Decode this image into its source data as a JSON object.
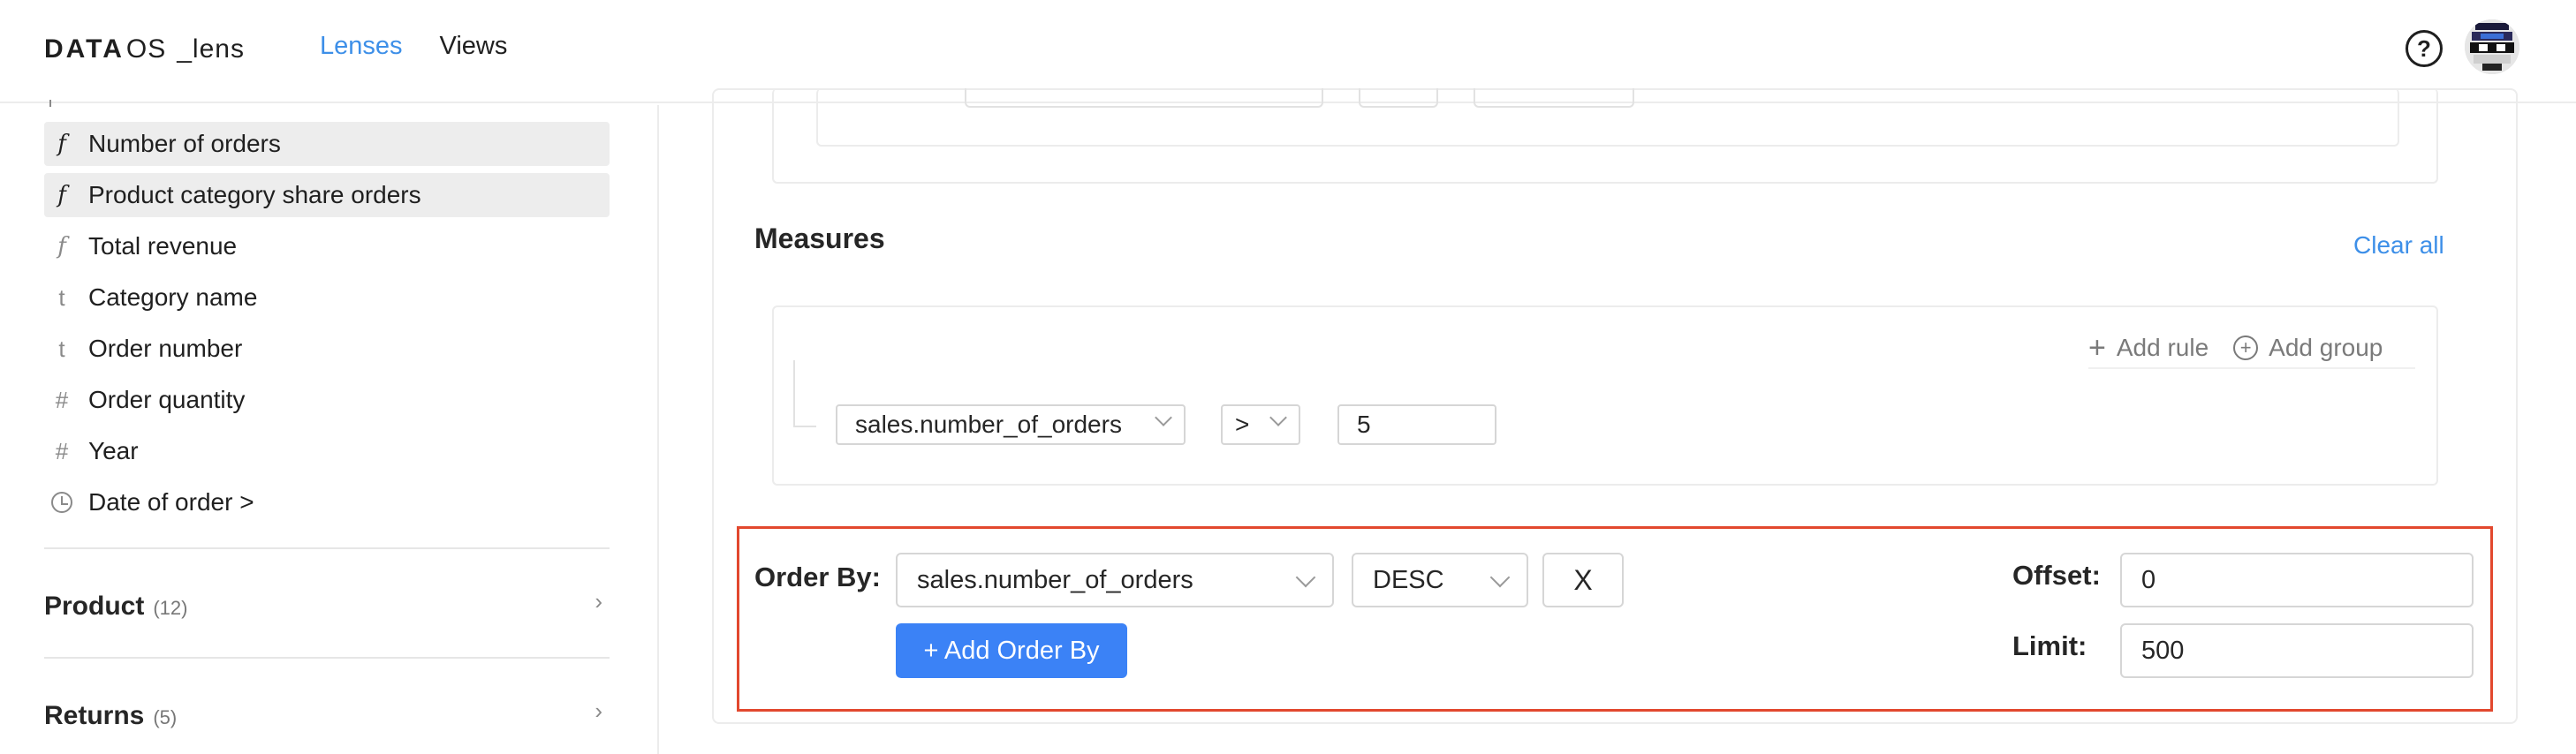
{
  "header": {
    "logo_brand": "DATA",
    "logo_os": "OS",
    "logo_product": "_lens",
    "nav": {
      "lenses": "Lenses",
      "views": "Views"
    },
    "help_label": "?"
  },
  "sidebar": {
    "items": [
      {
        "icon": "f",
        "label": "Number of orders"
      },
      {
        "icon": "f",
        "label": "Product category share orders"
      },
      {
        "icon": "f",
        "label": "Total revenue"
      },
      {
        "icon": "t",
        "label": "Category name"
      },
      {
        "icon": "t",
        "label": "Order number"
      },
      {
        "icon": "#",
        "label": "Order quantity"
      },
      {
        "icon": "#",
        "label": "Year"
      },
      {
        "icon": "clock",
        "label": "Date of order  >"
      }
    ],
    "groups": [
      {
        "name": "Product",
        "count": "(12)"
      },
      {
        "name": "Returns",
        "count": "(5)"
      }
    ]
  },
  "measures": {
    "title": "Measures",
    "clear_all": "Clear all",
    "add_rule": "Add rule",
    "add_group": "Add group",
    "rule": {
      "field": "sales.number_of_orders",
      "operator": ">",
      "value": "5"
    }
  },
  "order_by": {
    "label": "Order By:",
    "field": "sales.number_of_orders",
    "direction": "DESC",
    "remove_label": "X",
    "add_label": "+ Add Order By",
    "offset_label": "Offset:",
    "offset_value": "0",
    "limit_label": "Limit:",
    "limit_value": "500"
  },
  "colors": {
    "accent": "#3d8fe8",
    "button": "#3b82f6",
    "highlight_border": "#e2482e"
  }
}
